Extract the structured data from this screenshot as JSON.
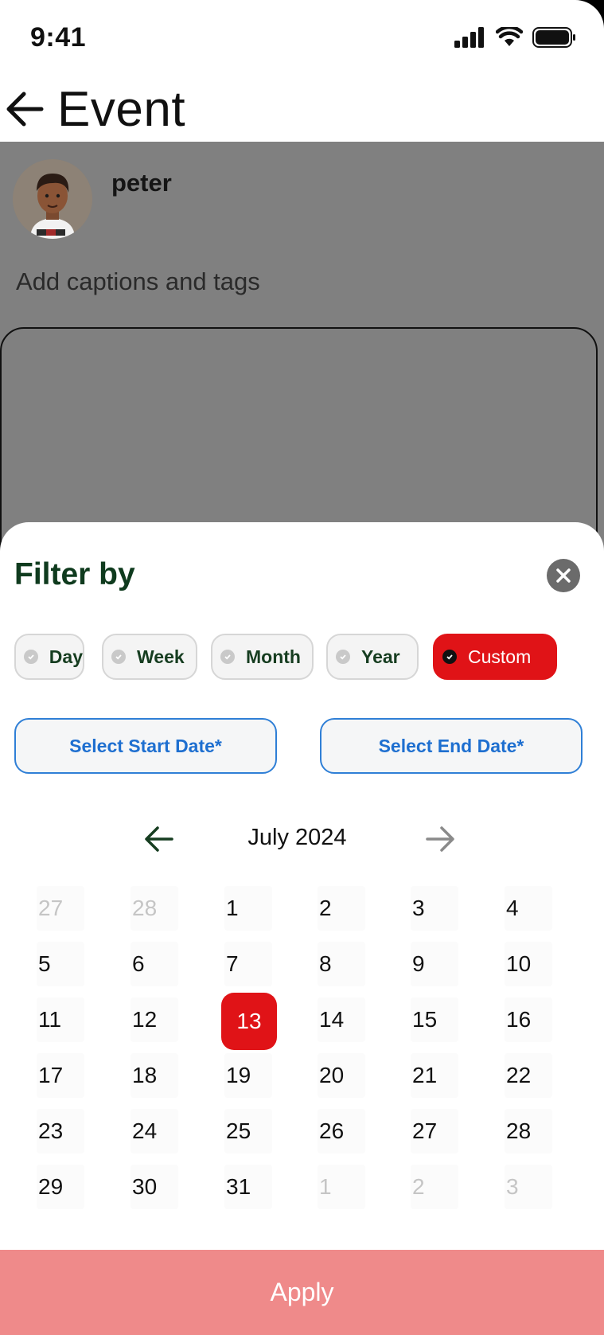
{
  "status": {
    "time": "9:41"
  },
  "header": {
    "title": "Event"
  },
  "composer": {
    "user_name": "peter",
    "caption_placeholder": "Add captions and tags"
  },
  "sheet": {
    "title": "Filter by",
    "chips": [
      {
        "label": "Day",
        "selected": false
      },
      {
        "label": "Week",
        "selected": false
      },
      {
        "label": "Month",
        "selected": false
      },
      {
        "label": "Year",
        "selected": false
      },
      {
        "label": "Custom",
        "selected": true
      }
    ],
    "start_date_label": "Select Start Date*",
    "end_date_label": "Select End Date*",
    "month_label": "July 2024",
    "calendar": [
      [
        {
          "d": "27",
          "muted": true
        },
        {
          "d": "28",
          "muted": true
        },
        {
          "d": "1"
        },
        {
          "d": "2"
        },
        {
          "d": "3"
        },
        {
          "d": "4"
        }
      ],
      [
        {
          "d": "5"
        },
        {
          "d": "6"
        },
        {
          "d": "7"
        },
        {
          "d": "8"
        },
        {
          "d": "9"
        },
        {
          "d": "10"
        }
      ],
      [
        {
          "d": "11"
        },
        {
          "d": "12"
        },
        {
          "d": "13",
          "selected": true
        },
        {
          "d": "14"
        },
        {
          "d": "15"
        },
        {
          "d": "16"
        }
      ],
      [
        {
          "d": "17"
        },
        {
          "d": "18"
        },
        {
          "d": "19"
        },
        {
          "d": "20"
        },
        {
          "d": "21"
        },
        {
          "d": "22"
        }
      ],
      [
        {
          "d": "23"
        },
        {
          "d": "24"
        },
        {
          "d": "25"
        },
        {
          "d": "26"
        },
        {
          "d": "27"
        },
        {
          "d": "28"
        }
      ],
      [
        {
          "d": "29"
        },
        {
          "d": "30"
        },
        {
          "d": "31"
        },
        {
          "d": "1",
          "muted": true
        },
        {
          "d": "2",
          "muted": true
        },
        {
          "d": "3",
          "muted": true
        }
      ]
    ],
    "apply_label": "Apply"
  },
  "colors": {
    "accent_red": "#e01317",
    "apply_disabled": "#ef8a8a",
    "title_green": "#0f3b1e",
    "date_blue": "#1e6fd0"
  }
}
